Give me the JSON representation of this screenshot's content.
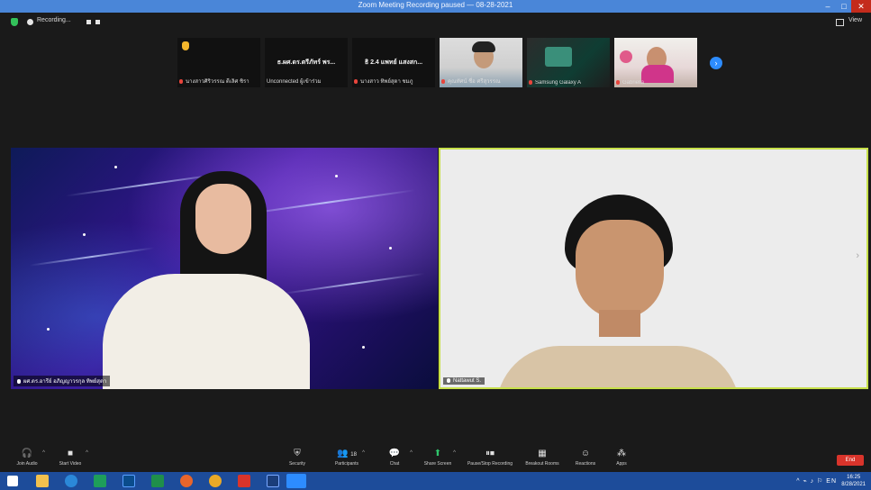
{
  "window": {
    "title": "Zoom Meeting  Recording paused — 08-28-2021"
  },
  "topbar": {
    "recording_label": "Recording...",
    "view_label": "View"
  },
  "thumbnails": [
    {
      "name": "นางสาวศิริวรรณ ดีเลิศ ชิรา",
      "center_name": "",
      "muted": true,
      "raised_hand": true
    },
    {
      "name": "Unconnected ผู้เข้าร่วม",
      "center_name": "ธ.ผศ.ดร.ตรีภัทร์ พร...",
      "muted": false
    },
    {
      "name": "นางสาว ทิพย์สุดา ชมภู",
      "center_name": "ธิ 2.4 แพทย์ แสงสก...",
      "muted": true
    },
    {
      "name": "คุณทัศน์  ชื่อ ศรีสุวรรณ",
      "center_name": "",
      "muted": true
    },
    {
      "name": "Samsung Galaxy A",
      "center_name": "",
      "muted": true
    },
    {
      "name": "Gabriella",
      "center_name": "",
      "muted": true
    }
  ],
  "main_tiles": {
    "left_name": "ผศ.ดร.อารีย์ อภิญญาวรกุล ทิพย์สุดา",
    "right_name": "Nattawut S."
  },
  "toolbar": {
    "items": [
      {
        "icon": "headphones-icon",
        "label": "Join Audio",
        "glyph": "🎧"
      },
      {
        "icon": "video-icon",
        "label": "Start Video",
        "glyph": "■"
      },
      {
        "icon": "shield-icon",
        "label": "Security",
        "glyph": "⛨"
      },
      {
        "icon": "participants-icon",
        "label": "Participants",
        "glyph": "👥",
        "count": "18"
      },
      {
        "icon": "chat-icon",
        "label": "Chat",
        "glyph": "💬"
      },
      {
        "icon": "share-screen-icon",
        "label": "Share Screen",
        "glyph": "⬆"
      },
      {
        "icon": "record-icon",
        "label": "Pause/Stop Recording",
        "glyph": "⏸⏹"
      },
      {
        "icon": "breakout-icon",
        "label": "Breakout Rooms",
        "glyph": "▦"
      },
      {
        "icon": "reactions-icon",
        "label": "Reactions",
        "glyph": "☺"
      },
      {
        "icon": "apps-icon",
        "label": "Apps",
        "glyph": "⁂"
      }
    ],
    "end_label": "End"
  },
  "taskbar": {
    "tray": "^ ⌁ ♪ ⚐ EN",
    "time": "16:25",
    "date": "8/28/2021"
  },
  "colors": {
    "accent": "#2d8cff",
    "active_speaker": "#c7e04a",
    "end_button": "#d9342b",
    "taskbar": "#1d4c9a"
  }
}
